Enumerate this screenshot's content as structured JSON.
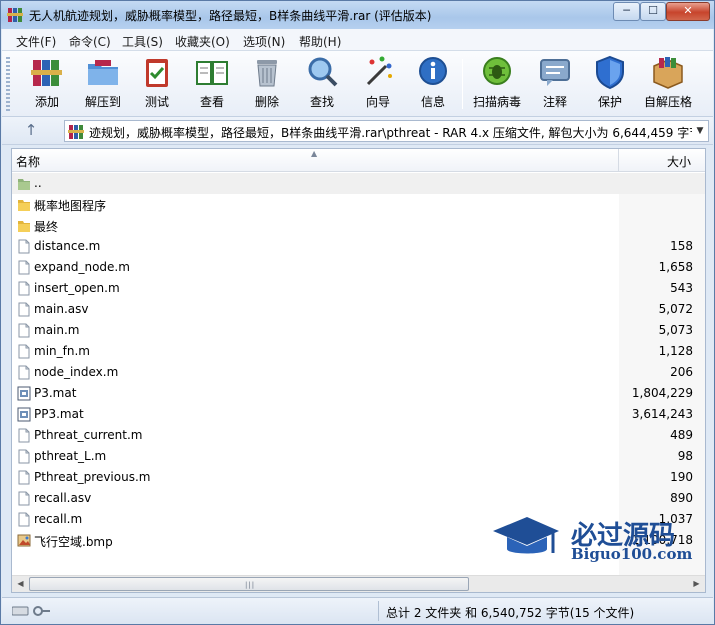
{
  "window": {
    "title": "无人机航迹规划，威胁概率模型，路径最短，B样条曲线平滑.rar (评估版本)",
    "min_label": "─",
    "max_label": "☐",
    "close_label": "✕"
  },
  "menu": [
    {
      "label": "文件(F)"
    },
    {
      "label": "命令(C)"
    },
    {
      "label": "工具(S)"
    },
    {
      "label": "收藏夹(O)"
    },
    {
      "label": "选项(N)"
    },
    {
      "label": "帮助(H)"
    }
  ],
  "toolbar": [
    {
      "label": "添加",
      "icon": "books-add-icon"
    },
    {
      "label": "解压到",
      "icon": "folder-extract-icon"
    },
    {
      "label": "测试",
      "icon": "clipboard-check-icon"
    },
    {
      "label": "查看",
      "icon": "book-view-icon"
    },
    {
      "label": "删除",
      "icon": "trash-icon"
    },
    {
      "label": "查找",
      "icon": "magnifier-icon"
    },
    {
      "label": "向导",
      "icon": "magic-wand-icon"
    },
    {
      "label": "信息",
      "icon": "info-icon"
    },
    {
      "label": "扫描病毒",
      "icon": "bug-scan-icon"
    },
    {
      "label": "注释",
      "icon": "comment-icon"
    },
    {
      "label": "保护",
      "icon": "shield-icon"
    },
    {
      "label": "自解压格",
      "icon": "box-sfx-icon"
    }
  ],
  "address": {
    "up_label": "↑",
    "path": "迹规划，威胁概率模型，路径最短，B样条曲线平滑.rar\\pthreat - RAR 4.x 压缩文件, 解包大小为 6,644,459 字节",
    "dropdown": "▼"
  },
  "columns": {
    "name": "名称",
    "size": "大小",
    "sort_indicator": "▲"
  },
  "files": [
    {
      "name": "..",
      "size": "",
      "icon": "parent-folder-icon"
    },
    {
      "name": "概率地图程序",
      "size": "",
      "icon": "folder-icon"
    },
    {
      "name": "最终",
      "size": "",
      "icon": "folder-icon"
    },
    {
      "name": "distance.m",
      "size": "158",
      "icon": "file-icon"
    },
    {
      "name": "expand_node.m",
      "size": "1,658",
      "icon": "file-icon"
    },
    {
      "name": "insert_open.m",
      "size": "543",
      "icon": "file-icon"
    },
    {
      "name": "main.asv",
      "size": "5,072",
      "icon": "file-icon"
    },
    {
      "name": "main.m",
      "size": "5,073",
      "icon": "file-icon"
    },
    {
      "name": "min_fn.m",
      "size": "1,128",
      "icon": "file-icon"
    },
    {
      "name": "node_index.m",
      "size": "206",
      "icon": "file-icon"
    },
    {
      "name": "P3.mat",
      "size": "1,804,229",
      "icon": "mat-file-icon"
    },
    {
      "name": "PP3.mat",
      "size": "3,614,243",
      "icon": "mat-file-icon"
    },
    {
      "name": "Pthreat_current.m",
      "size": "489",
      "icon": "file-icon"
    },
    {
      "name": "pthreat_L.m",
      "size": "98",
      "icon": "file-icon"
    },
    {
      "name": "Pthreat_previous.m",
      "size": "190",
      "icon": "file-icon"
    },
    {
      "name": "recall.asv",
      "size": "890",
      "icon": "file-icon"
    },
    {
      "name": "recall.m",
      "size": "1,037",
      "icon": "file-icon"
    },
    {
      "name": "飞行空域.bmp",
      "size": "1,100,718",
      "icon": "bmp-file-icon"
    }
  ],
  "status": {
    "text": "总计 2 文件夹 和 6,540,752 字节(15 个文件)"
  },
  "watermark": {
    "title": "必过源码",
    "url": "Biguo100.com"
  }
}
